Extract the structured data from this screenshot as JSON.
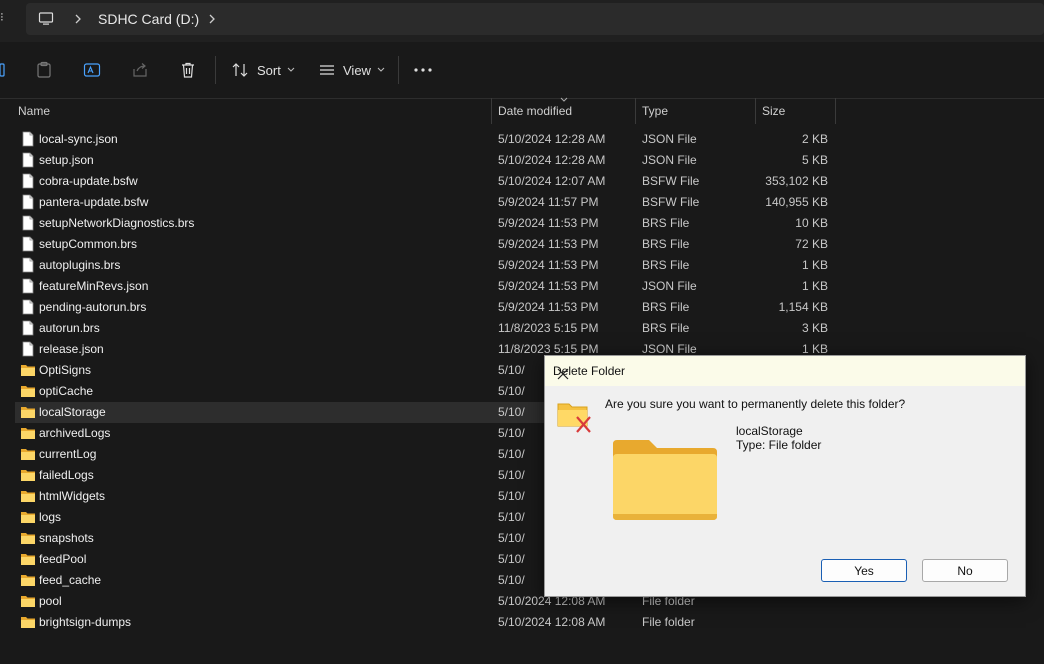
{
  "address": {
    "crumb": "SDHC Card (D:)"
  },
  "toolbar": {
    "sort_label": "Sort",
    "view_label": "View"
  },
  "columns": {
    "name": "Name",
    "date": "Date modified",
    "type": "Type",
    "size": "Size"
  },
  "files": [
    {
      "name": "local-sync.json",
      "date": "5/10/2024 12:28 AM",
      "type": "JSON File",
      "size": "2 KB"
    },
    {
      "name": "setup.json",
      "date": "5/10/2024 12:28 AM",
      "type": "JSON File",
      "size": "5 KB"
    },
    {
      "name": "cobra-update.bsfw",
      "date": "5/10/2024 12:07 AM",
      "type": "BSFW File",
      "size": "353,102 KB"
    },
    {
      "name": "pantera-update.bsfw",
      "date": "5/9/2024 11:57 PM",
      "type": "BSFW File",
      "size": "140,955 KB"
    },
    {
      "name": "setupNetworkDiagnostics.brs",
      "date": "5/9/2024 11:53 PM",
      "type": "BRS File",
      "size": "10 KB"
    },
    {
      "name": "setupCommon.brs",
      "date": "5/9/2024 11:53 PM",
      "type": "BRS File",
      "size": "72 KB"
    },
    {
      "name": "autoplugins.brs",
      "date": "5/9/2024 11:53 PM",
      "type": "BRS File",
      "size": "1 KB"
    },
    {
      "name": "featureMinRevs.json",
      "date": "5/9/2024 11:53 PM",
      "type": "JSON File",
      "size": "1 KB"
    },
    {
      "name": "pending-autorun.brs",
      "date": "5/9/2024 11:53 PM",
      "type": "BRS File",
      "size": "1,154 KB"
    },
    {
      "name": "autorun.brs",
      "date": "11/8/2023 5:15 PM",
      "type": "BRS File",
      "size": "3 KB"
    },
    {
      "name": "release.json",
      "date": "11/8/2023 5:15 PM",
      "type": "JSON File",
      "size": "1 KB"
    }
  ],
  "folders": [
    {
      "name": "OptiSigns",
      "date": "5/10/",
      "type": ""
    },
    {
      "name": "optiCache",
      "date": "5/10/",
      "type": ""
    },
    {
      "name": "localStorage",
      "date": "5/10/",
      "type": ""
    },
    {
      "name": "archivedLogs",
      "date": "5/10/",
      "type": ""
    },
    {
      "name": "currentLog",
      "date": "5/10/",
      "type": ""
    },
    {
      "name": "failedLogs",
      "date": "5/10/",
      "type": ""
    },
    {
      "name": "htmlWidgets",
      "date": "5/10/",
      "type": ""
    },
    {
      "name": "logs",
      "date": "5/10/",
      "type": ""
    },
    {
      "name": "snapshots",
      "date": "5/10/",
      "type": ""
    },
    {
      "name": "feedPool",
      "date": "5/10/",
      "type": ""
    },
    {
      "name": "feed_cache",
      "date": "5/10/",
      "type": ""
    },
    {
      "name": "pool",
      "date": "5/10/2024 12:08 AM",
      "type": "File folder"
    },
    {
      "name": "brightsign-dumps",
      "date": "5/10/2024 12:08 AM",
      "type": "File folder"
    }
  ],
  "selected_folder": "localStorage",
  "dialog": {
    "title": "Delete Folder",
    "question": "Are you sure you want to permanently delete this folder?",
    "item_name": "localStorage",
    "item_type": "Type: File folder",
    "yes_label": "Yes",
    "no_label": "No"
  },
  "colors": {
    "folder_yellow": "#f5c242",
    "accent": "#1a5fb4",
    "danger_x": "#d83b3b"
  }
}
